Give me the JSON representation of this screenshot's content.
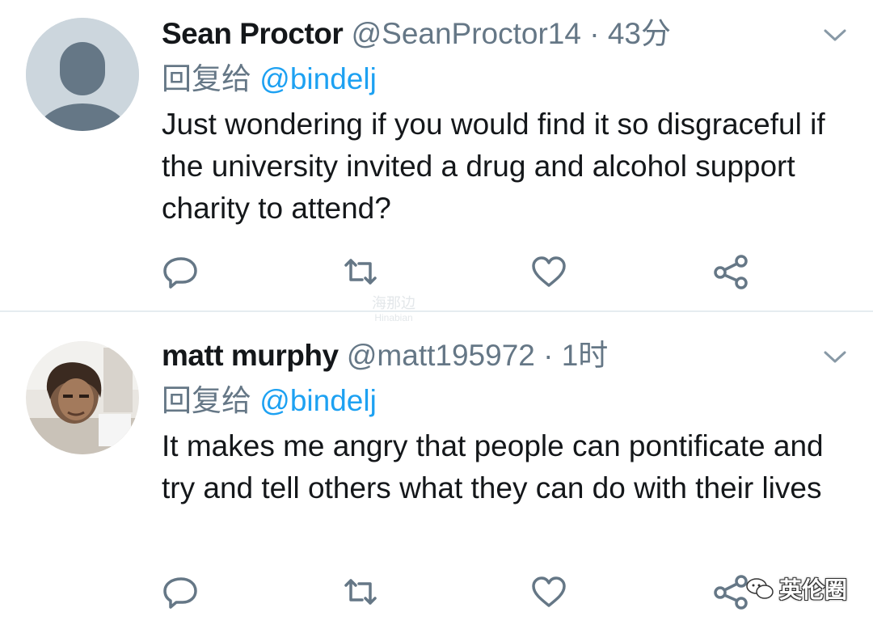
{
  "tweets": [
    {
      "name": "Sean Proctor",
      "handle": "@SeanProctor14",
      "separator": "·",
      "time": "43分",
      "reply_prefix": "回复给",
      "reply_to": "@bindelj",
      "text": "Just wondering if you would find it so disgraceful if the university invited a drug and alcohol support charity to attend?",
      "avatar": "default-avatar-icon"
    },
    {
      "name": "matt murphy",
      "handle": "@matt195972",
      "separator": "·",
      "time": "1时",
      "reply_prefix": "回复给",
      "reply_to": "@bindelj",
      "text": "It makes me angry that people can pontificate and try and tell others what they can do with their lives",
      "avatar": "user-photo-avatar"
    }
  ],
  "watermark": {
    "mid_top": "海那边",
    "mid_bottom": "Hinabian",
    "corner": "英伦圈"
  },
  "colors": {
    "text": "#14171a",
    "secondary": "#657786",
    "link": "#1da1f2",
    "divider": "#e6ecf0",
    "avatar_bg": "#ccd6dd",
    "avatar_fg": "#657786"
  }
}
